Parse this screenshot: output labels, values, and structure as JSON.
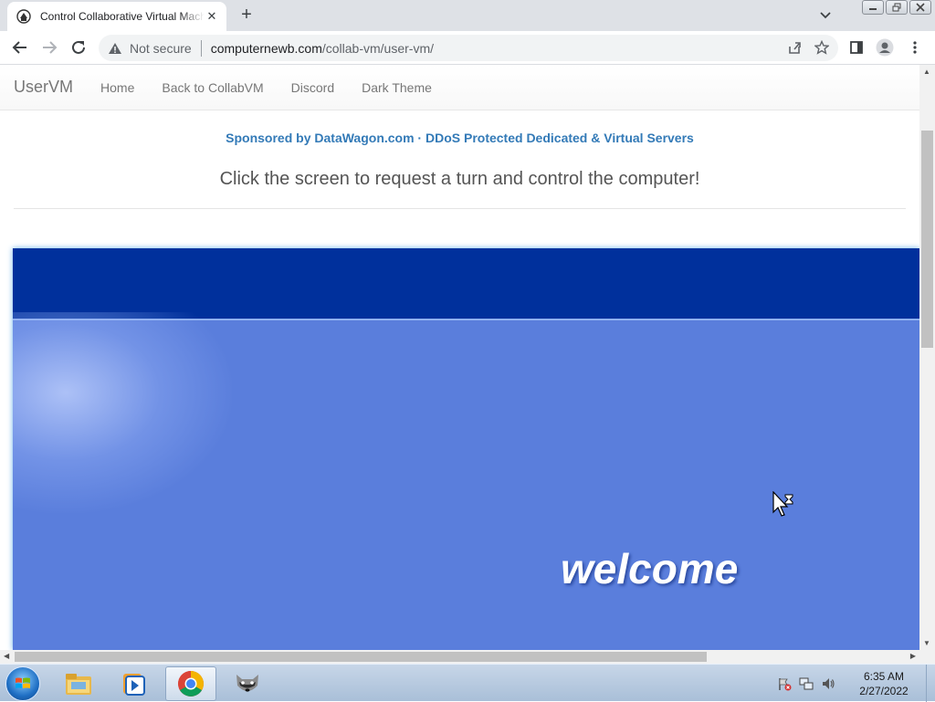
{
  "browser": {
    "tab_title": "Control Collaborative Virtual Machine",
    "security_label": "Not secure",
    "url_host": "computernewb.com",
    "url_path": "/collab-vm/user-vm/"
  },
  "navbar": {
    "brand": "UserVM",
    "links": [
      "Home",
      "Back to CollabVM",
      "Discord",
      "Dark Theme"
    ]
  },
  "sponsor": {
    "text": "Sponsored by DataWagon.com · DDoS Protected Dedicated & Virtual Servers"
  },
  "instructions": "Click the screen to request a turn and control the computer!",
  "vm": {
    "welcome_text": "welcome",
    "background_color": "#5a7edc",
    "topbar_color": "#00309c"
  },
  "taskbar": {
    "apps": [
      "explorer",
      "media-player",
      "chrome",
      "raccoon-app"
    ],
    "time": "6:35 AM",
    "date": "2/27/2022"
  }
}
